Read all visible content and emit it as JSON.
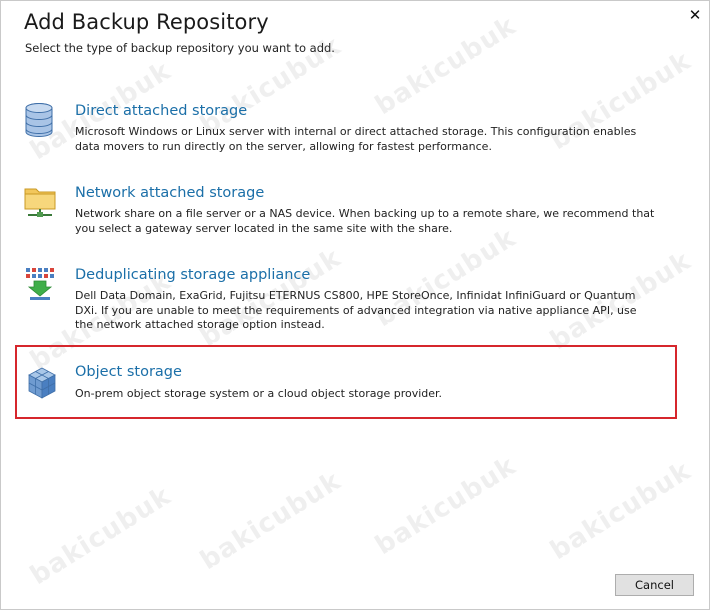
{
  "dialog": {
    "title": "Add Backup Repository",
    "subtitle": "Select the type of backup repository you want to add.",
    "close_symbol": "✕"
  },
  "options": [
    {
      "title": "Direct attached storage",
      "description": "Microsoft Windows or Linux server with internal or direct attached storage. This configuration enables data movers to run directly on the server, allowing for fastest performance.",
      "icon": "database-icon"
    },
    {
      "title": "Network attached storage",
      "description": "Network share on a file server or a NAS device. When backing up to a remote share, we recommend that you select a gateway server located in the same site with the share.",
      "icon": "network-folder-icon"
    },
    {
      "title": "Deduplicating storage appliance",
      "description": "Dell Data Domain, ExaGrid, Fujitsu ETERNUS CS800, HPE StoreOnce, Infinidat InfiniGuard or Quantum DXi. If you are unable to meet the requirements of advanced integration via native appliance API, use the network attached storage option instead.",
      "icon": "deduplication-icon"
    },
    {
      "title": "Object storage",
      "description": "On-prem object storage system or a cloud object storage provider.",
      "icon": "object-storage-icon",
      "highlighted": true
    }
  ],
  "footer": {
    "cancel_label": "Cancel"
  },
  "watermark_text": "bakicubuk",
  "colors": {
    "link": "#1b6fa8",
    "highlight_border": "#d6262c"
  }
}
